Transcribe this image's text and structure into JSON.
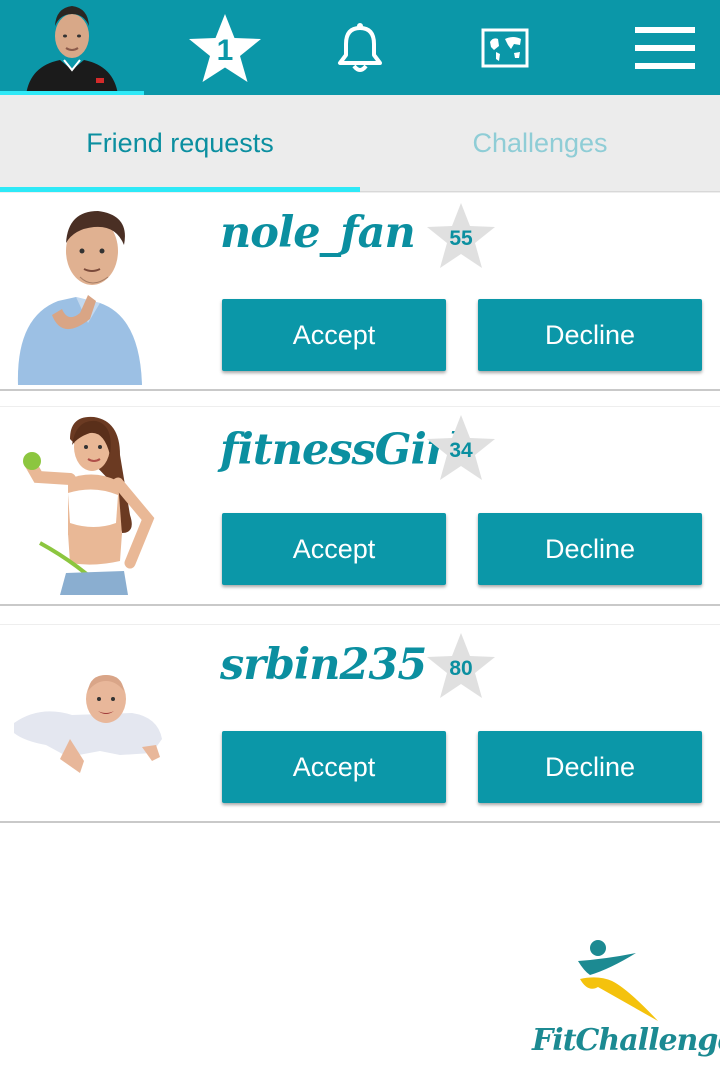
{
  "header": {
    "profile_avatar": "user-avatar-photo",
    "star_count": "1",
    "icons": [
      "star-icon",
      "bell-icon",
      "map-icon",
      "menu-icon"
    ]
  },
  "tabs": [
    {
      "label": "Friend requests",
      "active": true
    },
    {
      "label": "Challenges",
      "active": false
    }
  ],
  "requests": [
    {
      "username": "nole_fan",
      "score": "55",
      "accept_label": "Accept",
      "decline_label": "Decline"
    },
    {
      "username": "fitnessGirl",
      "score": "34",
      "accept_label": "Accept",
      "decline_label": "Decline"
    },
    {
      "username": "srbin235",
      "score": "80",
      "accept_label": "Accept",
      "decline_label": "Decline"
    }
  ],
  "logo": {
    "text": "FitChallenger"
  },
  "colors": {
    "primary": "#0b97a8",
    "accent": "#2ee9f7",
    "tab_bg": "#ececec",
    "inactive_tab_text": "#8fcdd6",
    "score_star": "#e0e0e0",
    "logo_yellow": "#f4c20d",
    "logo_green": "#1c8a92"
  }
}
